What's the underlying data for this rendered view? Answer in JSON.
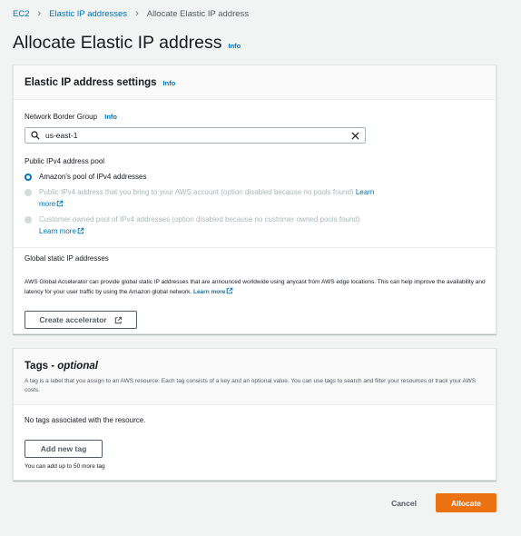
{
  "breadcrumb": {
    "items": [
      "EC2",
      "Elastic IP addresses",
      "Allocate Elastic IP address"
    ]
  },
  "page": {
    "title": "Allocate Elastic IP address",
    "info": "Info"
  },
  "settings": {
    "header": "Elastic IP address settings",
    "info": "Info",
    "network_border_group": {
      "label": "Network Border Group",
      "info": "Info",
      "value": "us-east-1"
    },
    "pool": {
      "label": "Public IPv4 address pool",
      "options": [
        {
          "text": "Amazon's pool of IPv4 addresses",
          "link": "",
          "selected": true,
          "disabled": false
        },
        {
          "text": "Public IPv4 address that you bring to your AWS account (option disabled because no pools found)",
          "link": "Learn more",
          "selected": false,
          "disabled": true
        },
        {
          "text": "Customer owned pool of IPv4 addresses (option disabled because no customer owned pools found)",
          "link": "Learn more",
          "selected": false,
          "disabled": true
        }
      ]
    },
    "global_static": {
      "title": "Global static IP addresses",
      "description": "AWS Global Accelerator can provide global static IP addresses that are announced worldwide using anycast from AWS edge locations. This can help improve the availability and latency for your user traffic by using the Amazon global network.",
      "link": "Learn more",
      "button": "Create accelerator"
    }
  },
  "tags": {
    "title": "Tags",
    "title_suffix": "optional",
    "description": "A tag is a label that you assign to an AWS resource. Each tag consists of a key and an optional value. You can use tags to search and filter your resources or track your AWS costs.",
    "empty": "No tags associated with the resource.",
    "add_button": "Add new tag",
    "limit": "You can add up to 50 more tag"
  },
  "footer": {
    "cancel": "Cancel",
    "allocate": "Allocate"
  },
  "colors": {
    "link": "#0073bb",
    "primary": "#ec7211",
    "background": "#f2f3f3"
  }
}
